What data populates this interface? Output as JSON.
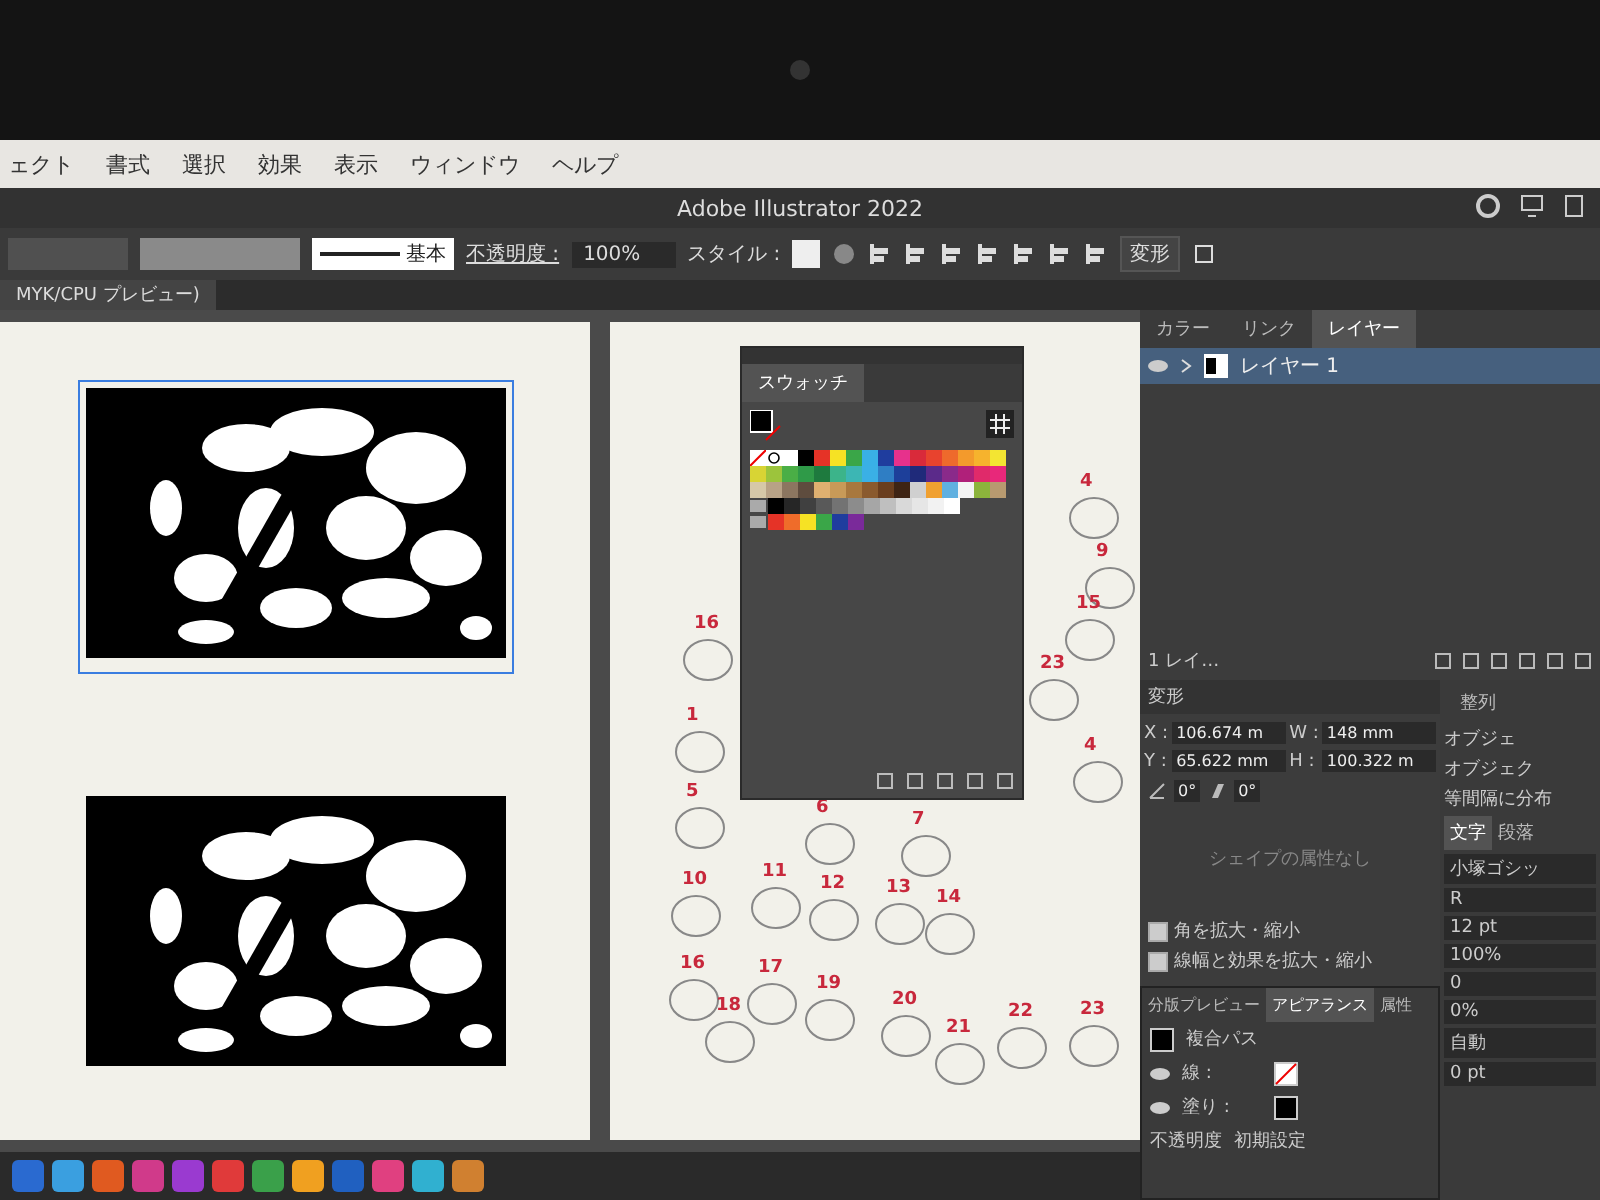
{
  "menu_bar": {
    "items": [
      "ェクト",
      "書式",
      "選択",
      "効果",
      "表示",
      "ウィンドウ",
      "ヘルプ"
    ]
  },
  "title_bar": {
    "title": "Adobe Illustrator 2022"
  },
  "control_bar": {
    "stroke_profile": "基本",
    "opacity_label": "不透明度 :",
    "opacity_value": "100%",
    "style_label": "スタイル :",
    "transform_button": "変形"
  },
  "document_tab": {
    "title": "MYK/CPU プレビュー)"
  },
  "canvas": {
    "artworks": [
      {
        "selected": true
      },
      {
        "selected": false
      }
    ],
    "pieces": [
      {
        "label": "4"
      },
      {
        "label": "9"
      },
      {
        "label": "15"
      },
      {
        "label": "16"
      },
      {
        "label": "23"
      },
      {
        "label": "1"
      },
      {
        "label": "4"
      },
      {
        "label": "5"
      },
      {
        "label": "6"
      },
      {
        "label": "7"
      },
      {
        "label": "10"
      },
      {
        "label": "11"
      },
      {
        "label": "12"
      },
      {
        "label": "13"
      },
      {
        "label": "14"
      },
      {
        "label": "16"
      },
      {
        "label": "17"
      },
      {
        "label": "18"
      },
      {
        "label": "19"
      },
      {
        "label": "20"
      },
      {
        "label": "21"
      },
      {
        "label": "22"
      },
      {
        "label": "23"
      }
    ]
  },
  "swatches_panel": {
    "tab": "スウォッチ",
    "rows": [
      {
        "swatches": [
          {
            "kind": "none"
          },
          {
            "kind": "registration"
          },
          {
            "kind": "color",
            "color": "#ffffff"
          },
          {
            "kind": "color",
            "color": "#000000"
          },
          {
            "kind": "color",
            "color": "#e53327"
          },
          {
            "kind": "color",
            "color": "#f6e224"
          },
          {
            "kind": "color",
            "color": "#3aa648"
          },
          {
            "kind": "color",
            "color": "#39b0e6"
          },
          {
            "kind": "color",
            "color": "#1f3d9e"
          },
          {
            "kind": "color",
            "color": "#e7318c"
          },
          {
            "kind": "color",
            "color": "#d92a3a"
          },
          {
            "kind": "color",
            "color": "#e8432e"
          },
          {
            "kind": "color",
            "color": "#ee6a2c"
          },
          {
            "kind": "color",
            "color": "#f39a2c"
          },
          {
            "kind": "color",
            "color": "#f6b32d"
          },
          {
            "kind": "color",
            "color": "#f3e532"
          }
        ]
      },
      {
        "swatches": [
          {
            "kind": "color",
            "color": "#d8d434"
          },
          {
            "kind": "color",
            "color": "#9cc43c"
          },
          {
            "kind": "color",
            "color": "#4aae46"
          },
          {
            "kind": "color",
            "color": "#2f9a48"
          },
          {
            "kind": "color",
            "color": "#1e7a3e"
          },
          {
            "kind": "color",
            "color": "#3cb48a"
          },
          {
            "kind": "color",
            "color": "#3cb6b4"
          },
          {
            "kind": "color",
            "color": "#3ab0e6"
          },
          {
            "kind": "color",
            "color": "#2f7ec4"
          },
          {
            "kind": "color",
            "color": "#1d3f9a"
          },
          {
            "kind": "color",
            "color": "#1f2a7a"
          },
          {
            "kind": "color",
            "color": "#5b2a8a"
          },
          {
            "kind": "color",
            "color": "#8a2a8a"
          },
          {
            "kind": "color",
            "color": "#b0207a"
          },
          {
            "kind": "color",
            "color": "#e02a6a"
          },
          {
            "kind": "color",
            "color": "#e8287a"
          }
        ]
      },
      {
        "swatches": [
          {
            "kind": "color",
            "color": "#d6c8a8"
          },
          {
            "kind": "color",
            "color": "#b8a286"
          },
          {
            "kind": "color",
            "color": "#8c7660"
          },
          {
            "kind": "color",
            "color": "#5e4c3e"
          },
          {
            "kind": "color",
            "color": "#e0b070"
          },
          {
            "kind": "color",
            "color": "#c89a58"
          },
          {
            "kind": "color",
            "color": "#a8783e"
          },
          {
            "kind": "color",
            "color": "#8a5a2e"
          },
          {
            "kind": "color",
            "color": "#6a3e1e"
          },
          {
            "kind": "color",
            "color": "#3e2414"
          },
          {
            "kind": "color",
            "color": "#d0d0d0"
          },
          {
            "kind": "color",
            "color": "#f0a030"
          },
          {
            "kind": "color",
            "color": "#60b0e0"
          },
          {
            "kind": "color",
            "color": "#f4f4f4"
          },
          {
            "kind": "color",
            "color": "#8cb43c"
          },
          {
            "kind": "color",
            "color": "#b89a70"
          }
        ]
      },
      {
        "swatches": [
          {
            "kind": "folder"
          },
          {
            "kind": "color",
            "color": "#000000"
          },
          {
            "kind": "color",
            "color": "#262626"
          },
          {
            "kind": "color",
            "color": "#404040"
          },
          {
            "kind": "color",
            "color": "#595959"
          },
          {
            "kind": "color",
            "color": "#737373"
          },
          {
            "kind": "color",
            "color": "#8c8c8c"
          },
          {
            "kind": "color",
            "color": "#a6a6a6"
          },
          {
            "kind": "color",
            "color": "#bfbfbf"
          },
          {
            "kind": "color",
            "color": "#d9d9d9"
          },
          {
            "kind": "color",
            "color": "#e6e6e6"
          },
          {
            "kind": "color",
            "color": "#f2f2f2"
          },
          {
            "kind": "color",
            "color": "#ffffff"
          }
        ]
      },
      {
        "swatches": [
          {
            "kind": "folder"
          },
          {
            "kind": "color",
            "color": "#e53327"
          },
          {
            "kind": "color",
            "color": "#ef6c2a"
          },
          {
            "kind": "color",
            "color": "#f6e224"
          },
          {
            "kind": "color",
            "color": "#3aa648"
          },
          {
            "kind": "color",
            "color": "#1f3d9e"
          },
          {
            "kind": "color",
            "color": "#7a2a9a"
          }
        ]
      }
    ]
  },
  "layers_panel": {
    "tabs": [
      {
        "label": "カラー",
        "selected": false
      },
      {
        "label": "リンク",
        "selected": false
      },
      {
        "label": "レイヤー",
        "selected": true
      }
    ],
    "layers": [
      {
        "name": "レイヤー 1",
        "selected": true,
        "visible": true
      }
    ],
    "footer": "1 レイ…"
  },
  "transform_panel": {
    "title": "変形",
    "fields": [
      {
        "label": "X :",
        "value": "106.674 m"
      },
      {
        "label": "W :",
        "value": "148 mm"
      },
      {
        "label": "Y :",
        "value": "65.622 mm"
      },
      {
        "label": "H :",
        "value": "100.322 m"
      }
    ],
    "angles": [
      {
        "kind": "rotate",
        "value": "0°"
      },
      {
        "kind": "shear",
        "value": "0°"
      }
    ],
    "message": "シェイプの属性なし",
    "options": [
      {
        "label": "角を拡大・縮小",
        "checked": true
      },
      {
        "label": "線幅と効果を拡大・縮小",
        "checked": true
      }
    ]
  },
  "appearance_panel": {
    "tabs": [
      {
        "label": "分版プレビュー",
        "selected": false
      },
      {
        "label": "アピアランス",
        "selected": true
      },
      {
        "label": "属性",
        "selected": false
      }
    ],
    "object": "複合パス",
    "attributes": [
      {
        "kind": "stroke",
        "label": "線 :"
      },
      {
        "kind": "fill",
        "label": "塗り :"
      }
    ],
    "opacity_label": "不透明度",
    "opacity_value": "初期設定"
  },
  "side_panel": {
    "align_tab": "整列",
    "labels": [
      "オブジェ",
      "オブジェク",
      "等間隔に分布"
    ],
    "tabs": [
      {
        "label": "文字",
        "selected": true
      },
      {
        "label": "段落",
        "selected": false
      }
    ],
    "font": "小塚ゴシッ",
    "style": "R",
    "fields": [
      "12 pt",
      "100%",
      "0",
      "0%",
      "自動",
      "0 pt"
    ]
  }
}
